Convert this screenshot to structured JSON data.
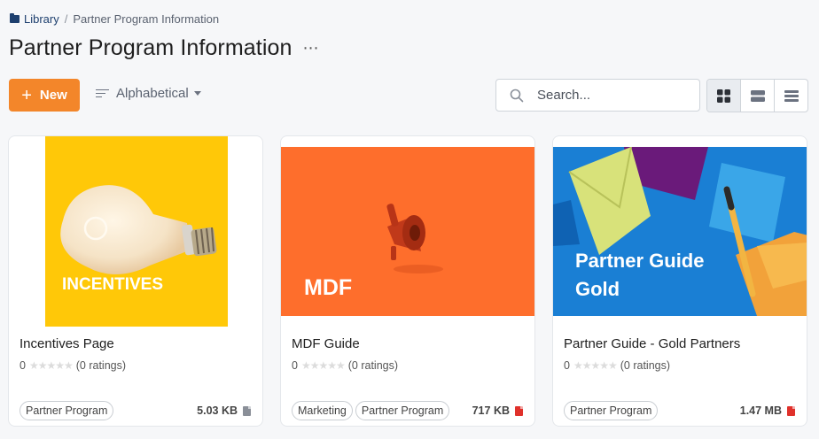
{
  "breadcrumb": {
    "root": "Library",
    "separator": "/",
    "current": "Partner Program Information"
  },
  "page": {
    "title": "Partner Program Information",
    "more": "⋯"
  },
  "toolbar": {
    "new_label": "New",
    "new_icon": "plus-icon",
    "sort_label": "Alphabetical",
    "search_placeholder": "Search...",
    "views": [
      "grid-view-icon",
      "card-view-icon",
      "list-view-icon"
    ],
    "active_view": "grid",
    "accent_color": "#f3862a"
  },
  "cards": [
    {
      "title": "Incentives Page",
      "rating_value": "0",
      "rating_count": "(0 ratings)",
      "thumb_text": "INCENTIVES",
      "thumb_color": "#ffc808",
      "tags": [
        "Partner Program"
      ],
      "size": "5.03 KB",
      "file_icon": "document-icon",
      "file_icon_color": "#8a8f98"
    },
    {
      "title": "MDF Guide",
      "rating_value": "0",
      "rating_count": "(0 ratings)",
      "thumb_text": "MDF",
      "thumb_color": "#fe6e2c",
      "tags": [
        "Marketing",
        "Partner Program"
      ],
      "size": "717 KB",
      "file_icon": "pdf-icon",
      "file_icon_color": "#e0312b"
    },
    {
      "title": "Partner Guide - Gold Partners",
      "rating_value": "0",
      "rating_count": "(0 ratings)",
      "thumb_text_line1": "Partner Guide",
      "thumb_text_line2": "Gold",
      "thumb_color": "#1a7fd4",
      "tags": [
        "Partner Program"
      ],
      "size": "1.47 MB",
      "file_icon": "pdf-icon",
      "file_icon_color": "#e0312b"
    }
  ]
}
